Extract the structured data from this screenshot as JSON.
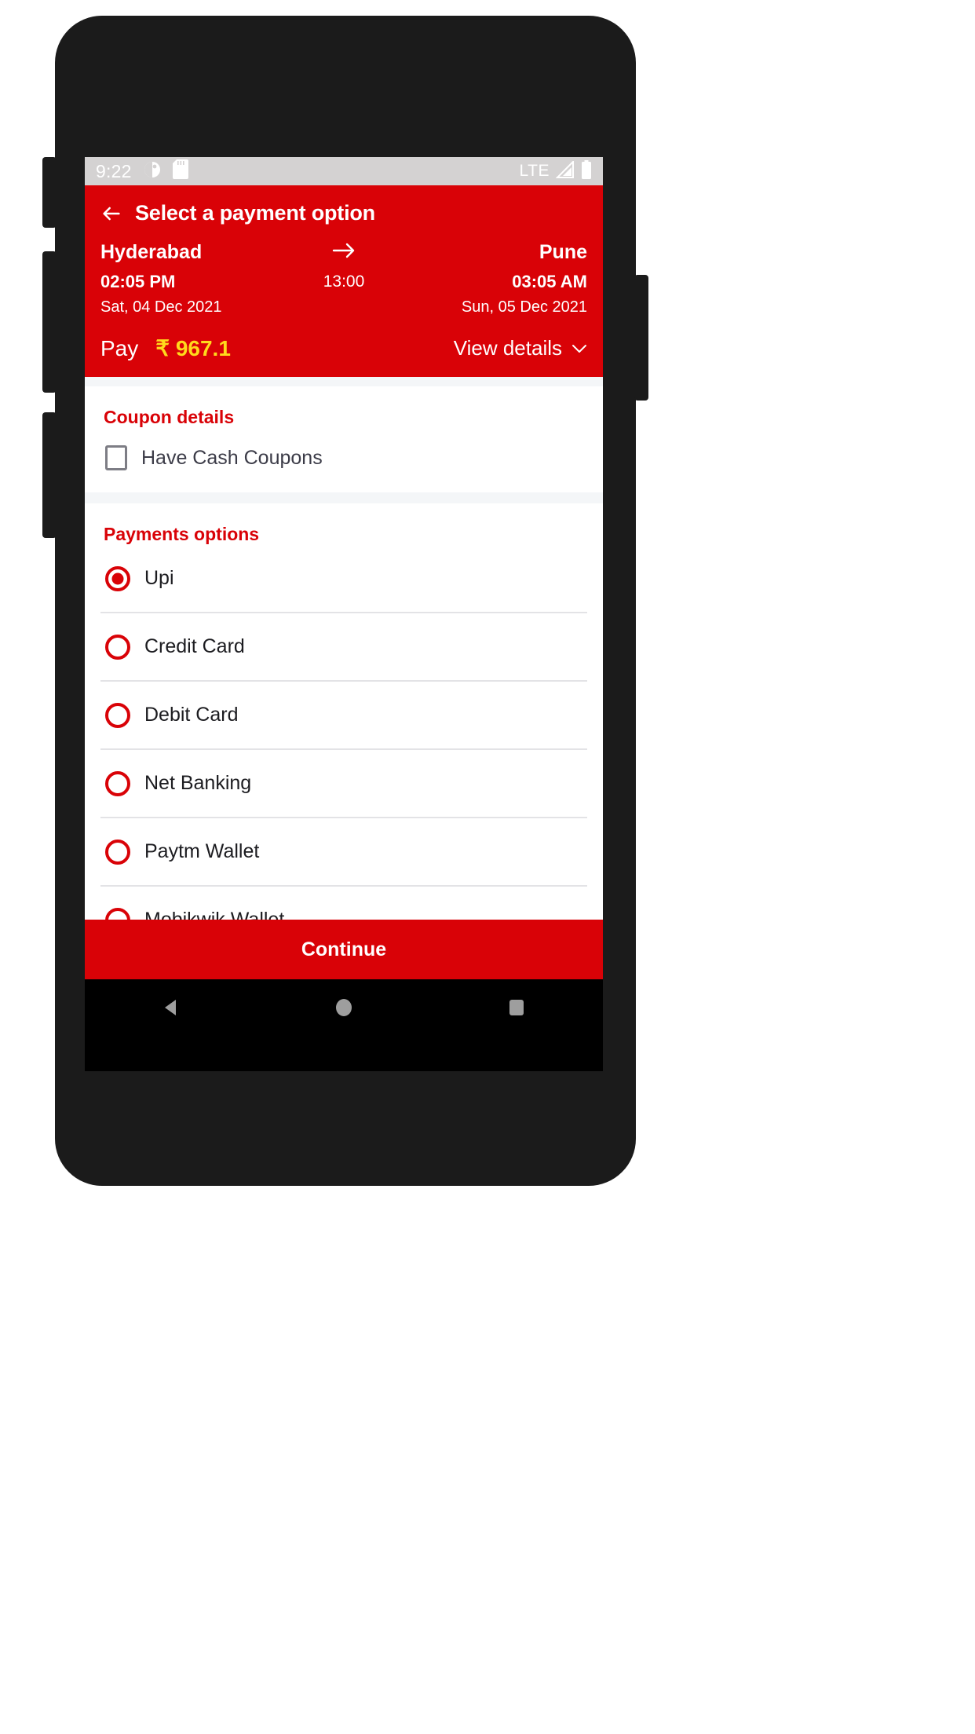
{
  "status_bar": {
    "clock": "9:22",
    "icons_left": [
      "do-not-disturb-icon",
      "sd-card-icon"
    ],
    "network": "LTE",
    "icons_right": [
      "signal-icon",
      "battery-icon"
    ],
    "background_color": "#d4d2d2"
  },
  "app_bar": {
    "back_icon": "back-arrow-icon",
    "title": "Select a payment option",
    "background_color": "#d90207"
  },
  "journey": {
    "from_city": "Hyderabad",
    "to_city": "Pune",
    "arrow_icon": "arrow-right-icon",
    "depart_time": "02:05 PM",
    "arrive_time": "03:05 AM",
    "duration": "13:00",
    "depart_date": "Sat, 04 Dec 2021",
    "arrive_date": "Sun, 05 Dec 2021"
  },
  "pay": {
    "label": "Pay",
    "amount": "₹ 967.1",
    "amount_color": "#ffd91c",
    "view_details_label": "View details",
    "chevron_icon": "chevron-down-icon"
  },
  "coupon": {
    "section_title": "Coupon details",
    "checkbox_label": "Have Cash Coupons",
    "checked": false
  },
  "payments": {
    "section_title": "Payments options",
    "options": [
      {
        "label": "Upi",
        "selected": true
      },
      {
        "label": "Credit Card",
        "selected": false
      },
      {
        "label": "Debit Card",
        "selected": false
      },
      {
        "label": "Net Banking",
        "selected": false
      },
      {
        "label": "Paytm Wallet",
        "selected": false
      },
      {
        "label": "Mobikwik Wallet",
        "selected": false
      }
    ]
  },
  "footer": {
    "continue_label": "Continue"
  },
  "nav_bar": {
    "back_icon": "nav-back-triangle-icon",
    "home_icon": "nav-home-circle-icon",
    "recents_icon": "nav-recents-square-icon"
  },
  "theme": {
    "brand_red": "#d90207",
    "accent_yellow": "#ffd91c"
  }
}
